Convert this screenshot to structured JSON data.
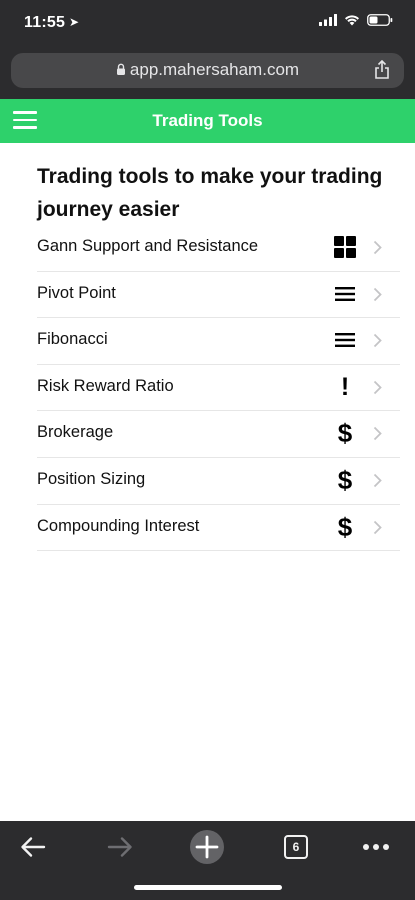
{
  "status_bar": {
    "time": "11:55"
  },
  "browser": {
    "url": "app.mahersaham.com",
    "tab_count": "6"
  },
  "header": {
    "title": "Trading Tools"
  },
  "main": {
    "heading": "Trading tools to make your trading journey easier",
    "tools": [
      {
        "label": "Gann Support and Resistance",
        "icon": "grid-icon"
      },
      {
        "label": "Pivot Point",
        "icon": "list-icon"
      },
      {
        "label": "Fibonacci",
        "icon": "list-icon"
      },
      {
        "label": "Risk Reward Ratio",
        "icon": "exclamation-icon",
        "glyph": "!"
      },
      {
        "label": "Brokerage",
        "icon": "dollar-icon",
        "glyph": "$"
      },
      {
        "label": "Position Sizing",
        "icon": "dollar-icon",
        "glyph": "$"
      },
      {
        "label": "Compounding Interest",
        "icon": "dollar-icon",
        "glyph": "$"
      }
    ]
  },
  "colors": {
    "header_bg": "#2ed16b",
    "chrome_bg": "#2c2c2e"
  }
}
